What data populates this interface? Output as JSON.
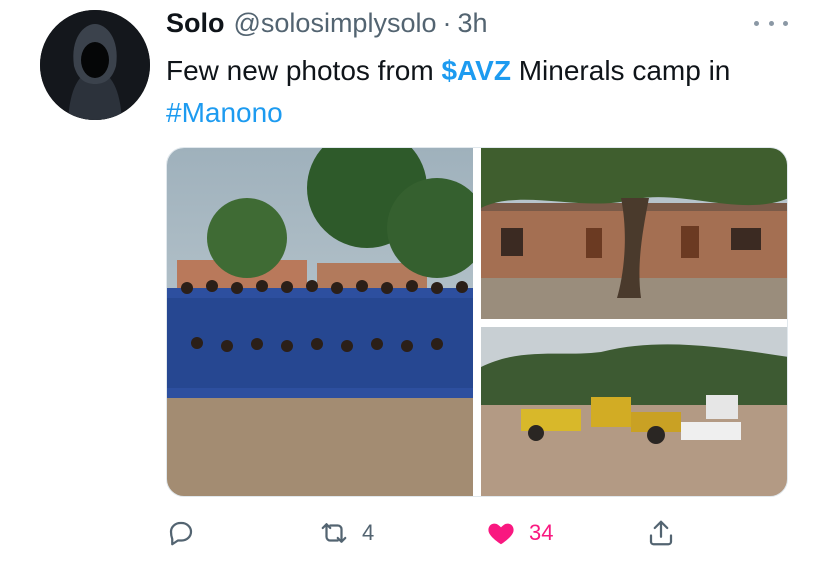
{
  "tweet": {
    "author_name": "Solo",
    "author_handle": "@solosimplysolo",
    "separator": "·",
    "time": "3h",
    "text_part1": "Few new photos from ",
    "cashtag": "$AVZ",
    "text_part2": " Minerals camp in ",
    "hashtag": "#Manono",
    "media": [
      {
        "alt": "group photo of workers in blue uniforms"
      },
      {
        "alt": "buildings behind a large tree"
      },
      {
        "alt": "yellow construction machines"
      }
    ],
    "actions": {
      "reply_icon": "reply-icon",
      "retweet_icon": "retweet-icon",
      "retweet_count": "4",
      "like_icon": "heart-icon",
      "like_count": "34",
      "share_icon": "share-icon"
    },
    "colors": {
      "link": "#1d9bf0",
      "like": "#f91880",
      "muted": "#536471"
    }
  }
}
